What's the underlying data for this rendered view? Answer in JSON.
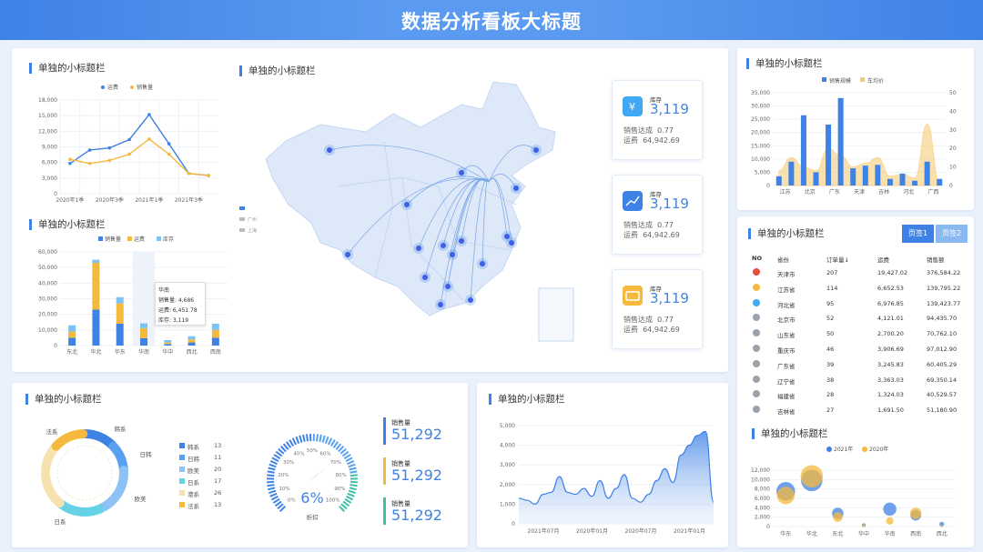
{
  "header": {
    "title": "数据分析看板大标题"
  },
  "panel_titles": {
    "line_chart": "单独的小标题栏",
    "bar_chart": "单独的小标题栏",
    "map": "单独的小标题栏",
    "combo_chart": "单独的小标题栏",
    "table": "单独的小标题栏",
    "donut": "单独的小标题栏",
    "area_chart": "单独的小标题栏",
    "bubble_chart": "单独的小标题栏"
  },
  "kpi_cards": [
    {
      "label": "库存",
      "value": "3,119",
      "rate_label": "销售达成",
      "rate": "0.77",
      "fee_label": "运费",
      "fee": "64,942.69",
      "icon": "money-icon",
      "color": "#3fa9f5"
    },
    {
      "label": "库存",
      "value": "3,119",
      "rate_label": "销售达成",
      "rate": "0.77",
      "fee_label": "运费",
      "fee": "64,942.69",
      "icon": "chart-icon",
      "color": "#3f82e6"
    },
    {
      "label": "库存",
      "value": "3,119",
      "rate_label": "销售达成",
      "rate": "0.77",
      "fee_label": "运费",
      "fee": "64,942.69",
      "icon": "wallet-icon",
      "color": "#f5b93e"
    }
  ],
  "map": {
    "legend": [
      "",
      "广州",
      "上海"
    ]
  },
  "tabs": {
    "tab1": "页签1",
    "tab2": "页签2"
  },
  "table": {
    "headers": [
      "NO",
      "省份",
      "订单量↓",
      "运费",
      "销售额"
    ],
    "rows": [
      [
        "天津市",
        "207",
        "19,427.02",
        "376,584.22"
      ],
      [
        "江苏省",
        "114",
        "6,652.53",
        "139,795.22"
      ],
      [
        "河北省",
        "95",
        "6,976.85",
        "139,423.77"
      ],
      [
        "北京市",
        "52",
        "4,121.01",
        "94,435.70"
      ],
      [
        "山东省",
        "50",
        "2,700.20",
        "70,762.10"
      ],
      [
        "重庆市",
        "46",
        "3,906.69",
        "97,012.90"
      ],
      [
        "广东省",
        "39",
        "3,245.83",
        "60,405.29"
      ],
      [
        "辽宁省",
        "38",
        "3,363.03",
        "69,350.14"
      ],
      [
        "福建省",
        "28",
        "1,324.03",
        "40,529.57"
      ],
      [
        "吉林省",
        "27",
        "1,691.50",
        "51,180.90"
      ]
    ]
  },
  "donut": {
    "slices": [
      {
        "name": "韩系",
        "value": 13,
        "color": "#3f82e6"
      },
      {
        "name": "日韩",
        "value": 11,
        "color": "#5aa0f0"
      },
      {
        "name": "欧美",
        "value": 20,
        "color": "#8cc2f5"
      },
      {
        "name": "日系",
        "value": 17,
        "color": "#66d2e6"
      },
      {
        "name": "港系",
        "value": 26,
        "color": "#f5e2ae"
      },
      {
        "name": "法系",
        "value": 13,
        "color": "#f5b93e"
      }
    ],
    "labels": [
      "韩系",
      "日韩",
      "欧美",
      "日系",
      "法系"
    ]
  },
  "gauge": {
    "value": "6%",
    "label": "折扣",
    "ticks": [
      "0%",
      "10%",
      "20%",
      "30%",
      "40%",
      "50%",
      "60%",
      "70%",
      "80%",
      "90%",
      "100%"
    ],
    "fraction": 0.06
  },
  "stats": [
    {
      "label": "销售量",
      "value": "51,292",
      "color": "#3f82e6"
    },
    {
      "label": "销售量",
      "value": "51,292",
      "color": "#f5b93e"
    },
    {
      "label": "销售量",
      "value": "51,292",
      "color": "#3fbfa5"
    }
  ],
  "chart_data": [
    {
      "type": "line",
      "title": "单独的小标题栏",
      "x": [
        "2020年1季",
        "",
        "2020年3季",
        "",
        "2021年1季",
        "",
        "2021年3季",
        ""
      ],
      "series": [
        {
          "name": "运费",
          "color": "#3f82e6",
          "values": [
            5800,
            8400,
            8800,
            10400,
            15200,
            9600,
            3900,
            3500
          ]
        },
        {
          "name": "销售量",
          "color": "#f5b93e",
          "values": [
            6600,
            5800,
            6400,
            7600,
            10500,
            7600,
            3900,
            3500
          ]
        }
      ],
      "ylim": [
        0,
        18000
      ],
      "yticks": [
        "18,000",
        "15,000",
        "12,000",
        "9,000",
        "6,000",
        "3,000",
        "0"
      ]
    },
    {
      "type": "bar",
      "title": "单独的小标题栏",
      "categories": [
        "东北",
        "华北",
        "华东",
        "华南",
        "华中",
        "西北",
        "西南"
      ],
      "series": [
        {
          "name": "销售量",
          "color": "#3f82e6",
          "values": [
            5000,
            23000,
            14000,
            4686,
            1000,
            2000,
            5000
          ]
        },
        {
          "name": "运费",
          "color": "#f5b93e",
          "values": [
            4000,
            30000,
            13000,
            6452,
            1000,
            2000,
            5000
          ]
        },
        {
          "name": "库存",
          "color": "#7cc3f5",
          "values": [
            4000,
            2000,
            4000,
            3119,
            1500,
            2000,
            4000
          ]
        }
      ],
      "ylim": [
        0,
        60000
      ],
      "yticks": [
        "60,000",
        "50,000",
        "40,000",
        "30,000",
        "20,000",
        "10,000",
        "0"
      ],
      "tooltip": {
        "title": "华南",
        "lines": [
          "销售量: 4,686",
          "运费: 6,451.78",
          "库存: 3,119"
        ]
      }
    },
    {
      "type": "bar",
      "title": "单独的小标题栏",
      "categories": [
        "江苏",
        "北京",
        "广东",
        "天津",
        "吉林",
        "河北",
        "广西"
      ],
      "series": [
        {
          "name": "销售规模",
          "color": "#3f82e6",
          "values": [
            3500,
            9000,
            26500,
            5000,
            23000,
            33000,
            6500,
            7500,
            7800,
            2500,
            4500,
            1800,
            9000,
            2500
          ]
        },
        {
          "name": "车均价",
          "color": "#f5c96e",
          "values": [
            8,
            15,
            10,
            8,
            20,
            16,
            10,
            12,
            15,
            5,
            6,
            4,
            33,
            2
          ]
        }
      ],
      "ylim": [
        0,
        40000
      ],
      "y2lim": [
        0,
        50
      ],
      "yticks": [
        "35,000",
        "30,000",
        "25,000",
        "20,000",
        "15,000",
        "10,000",
        "5,000",
        "0"
      ],
      "y2ticks": [
        "50",
        "40",
        "30",
        "20",
        "10",
        "0"
      ]
    },
    {
      "type": "area",
      "title": "单独的小标题栏",
      "x": [
        "2021年07月",
        "2020年01月",
        "2020年07月",
        "2021年01月"
      ],
      "ylim": [
        0,
        5000
      ],
      "yticks": [
        "5,000",
        "4,000",
        "3,000",
        "2,000",
        "1,000",
        "0"
      ],
      "values": [
        1300,
        1200,
        1000,
        1500,
        1600,
        2400,
        1600,
        1500,
        1800,
        1400,
        2200,
        1300,
        1800,
        2500,
        1300,
        1100,
        1500,
        2200,
        2800,
        2100,
        3500,
        4000,
        4500,
        4700,
        1100
      ]
    },
    {
      "type": "scatter",
      "title": "单独的小标题栏",
      "categories": [
        "华东",
        "华北",
        "东北",
        "华中",
        "华南",
        "西南",
        "西北"
      ],
      "series": [
        {
          "name": "2021年",
          "color": "#3f82e6",
          "values": [
            7500,
            9800,
            2800,
            300,
            3700,
            2400,
            500
          ]
        },
        {
          "name": "2020年",
          "color": "#f5b93e",
          "values": [
            6600,
            10700,
            2000,
            200,
            1200,
            2800,
            100
          ]
        }
      ],
      "ylim": [
        0,
        12000
      ],
      "yticks": [
        "12,000",
        "10,000",
        "8,000",
        "6,000",
        "4,000",
        "2,000",
        "0"
      ]
    }
  ]
}
